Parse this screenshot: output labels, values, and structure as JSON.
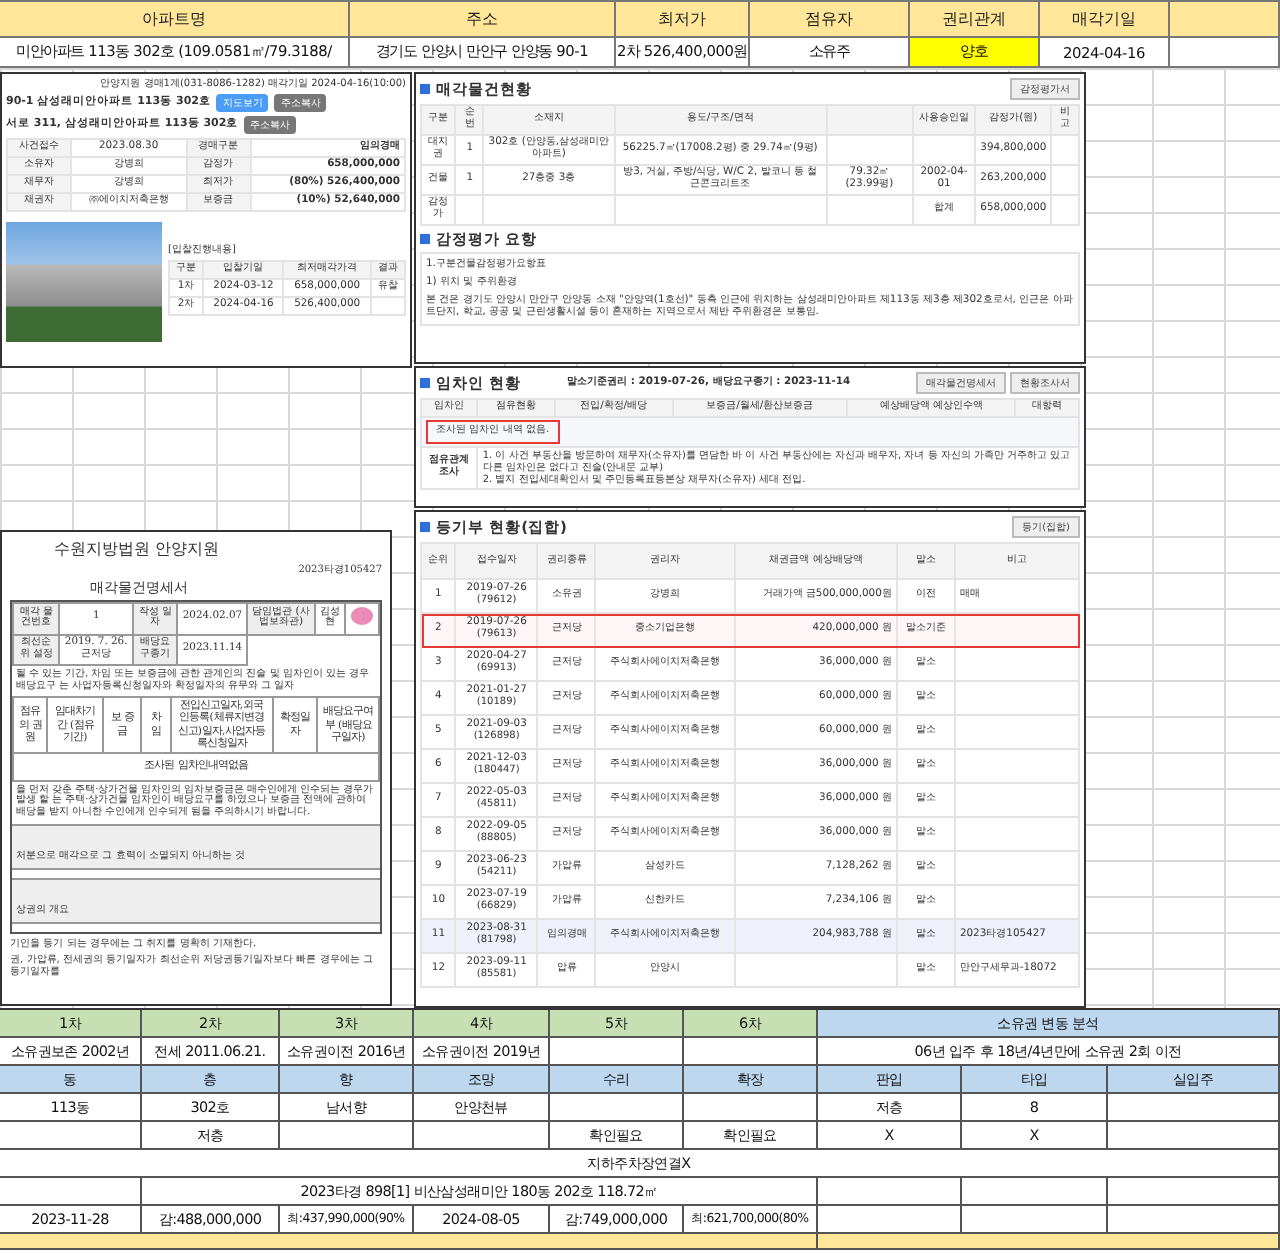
{
  "sheet": {
    "columns": [
      "아파트명",
      "주소",
      "최저가",
      "점유자",
      "권리관계",
      "매각기일"
    ],
    "row": [
      {
        "text": "미안아파트 113동 302호 (109.0581㎡/79.3188/",
        "highlighted": false
      },
      {
        "text": "경기도 안양시 만안구 안양동 90-1",
        "highlighted": false
      },
      {
        "text": "2차 526,400,000원",
        "highlighted": false
      },
      {
        "text": "소유주",
        "highlighted": false
      },
      {
        "text": "양호",
        "highlighted": true
      },
      {
        "text": "2024-04-16",
        "highlighted": false
      }
    ]
  },
  "auction_card": {
    "court_line": "안양지원 경매1계(031-8086-1282) 매각기일 2024-04-16(10:00)",
    "address_lines": [
      {
        "text": "90-1 삼성래미안아파트 113동 302호",
        "buttons": [
          {
            "label": "지도보기",
            "kind": "primary"
          },
          {
            "label": "주소복사",
            "kind": "plain"
          }
        ]
      },
      {
        "text": "서로 311, 삼성래미안아파트 113동 302호",
        "buttons": [
          {
            "label": "주소복사",
            "kind": "plain"
          }
        ]
      }
    ],
    "info": [
      [
        "사건접수",
        "2023.08.30",
        "경매구분",
        "임의경매"
      ],
      [
        "소유자",
        "강병희",
        "감정가",
        "658,000,000"
      ],
      [
        "채무자",
        "강병희",
        "최저가",
        "(80%) 526,400,000"
      ],
      [
        "채권자",
        "㈜에이치저축은행",
        "보증금",
        "(10%) 52,640,000"
      ]
    ],
    "rounds_title": "[입찰진행내용]",
    "rounds_columns": [
      "구분",
      "입찰기일",
      "최저매각가격",
      "결과"
    ],
    "rounds": [
      [
        "1차",
        "2024-03-12",
        "658,000,000",
        "유찰"
      ],
      [
        "2차",
        "2024-04-16",
        "526,400,000"
      ]
    ]
  },
  "property_panel": {
    "title": "매각물건현황",
    "button": "감정평가서",
    "columns": [
      "구분",
      "순번",
      "소재지",
      "용도/구조/면적",
      "",
      "사용승인일",
      "감정가(원)",
      "비고"
    ],
    "rows": [
      [
        "대지권",
        "1",
        "302호 (안양동,삼성래미안아파트)",
        "56225.7㎡(17008.2평) 중 29.74㎡(9평)",
        "",
        "",
        "394,800,000",
        ""
      ],
      [
        "건물",
        "1",
        "27층중 3층",
        "방3, 거실, 주방/식당, W/C 2, 발코니 등 철근콘크리트조",
        "79.32㎡ (23.99평)",
        "2002-04-01",
        "263,200,000",
        ""
      ],
      [
        "감정가",
        "",
        "",
        "",
        "",
        "합계",
        "658,000,000",
        ""
      ]
    ],
    "summary_title": "감정평가 요항",
    "summary": [
      "1.구분건물감정평가요항표",
      "1) 위치 및 주위환경",
      "본 건은 경기도 안양시 만안구 안양동 소재 \"안양역(1호선)\" 동측 인근에 위치하는 삼성래미안아파트 제113동 제3층 제302호로서, 인근은 아파트단지, 학교, 공공 및 근린생활시설 등이 혼재하는 지역으로서 제반 주위환경은 보통임."
    ]
  },
  "tenant_panel": {
    "title": "임차인 현황",
    "dates": "말소기준권리 : 2019-07-26, 배당요구종기 : 2023-11-14",
    "buttons": [
      "매각물건명세서",
      "현황조사서"
    ],
    "columns": [
      "임차인",
      "점유현황",
      "전입/확정/배당",
      "보증금/월세/환산보증금",
      "예상배당액 예상인수액",
      "대항력"
    ],
    "note": {
      "text": "조사된 임차인 내역 없음.",
      "boxed": true
    },
    "survey_label": "점유관계조사",
    "survey": [
      "1. 이 사건 부동산을 방문하여 채무자(소유자)를 면담한 바 이 사건 부동산에는 자신과 배우자, 자녀 등 자신의 가족만 거주하고 있고 다른 임차인은 없다고 진술(안내문 교부)",
      "2. 별지 전입세대확인서 및 주민등록표등본상 채무자(소유자) 세대 전입."
    ]
  },
  "court_document": {
    "court": "수원지방법원 안양지원",
    "case_no": "2023타경105427",
    "title": "매각물건명세서",
    "head_rows": [
      [
        "매각 물건번호",
        "1",
        "작성 일자",
        "2024.02.07",
        "담임법관 (사법보좌관)",
        "김성현"
      ],
      [
        "최선순위 설정",
        "2019. 7. 26. 근저당",
        "배당요구종기",
        "2023.11.14"
      ]
    ],
    "intro": "될 수 있는 기간, 차임 또는 보증금에 관한 관계인의 진술 및 임차인이 있는 경우 배당요구 는 사업자등록신청일자와 확정일자의 유무와 그 일자",
    "columns": [
      "점유의 권 원",
      "임대차기간 (점유기간)",
      "보 증 금",
      "차 임",
      "전입신고일자,외국인등록(체류지변경신고)일자,사업자등록신청일자",
      "확정일자",
      "배당요구여부 (배당요구일자)"
    ],
    "empty_text": "조사된 임차인내역없음",
    "warning": "을 먼저 갖춘 주택·상가건물 임차인의 임차보증금은 매수인에게 인수되는 경우가 발생 할 는 주택·상가건물 임차인이 배당요구를 하였으나 보증금 전액에 관하여 배당을 받지 아니한 수인에게 인수되게 됨을 주의하시기 바랍니다.",
    "sections": [
      "처분으로 매각으로 그 효력이 소멸되지 아니하는 것",
      "상권의 개요"
    ],
    "footnotes": [
      "기인을 등기 되는 경우에는 그 취지를 명확히 기재한다.",
      "권, 가압류, 전세권의 등기일자가 최선순위 저당권등기일자보다 빠른 경우에는 그 등기일자를"
    ]
  },
  "registry_panel": {
    "title": "등기부 현황(집합)",
    "button": "등기(집합)",
    "columns": [
      "순위",
      "접수일자",
      "권리종류",
      "권리자",
      "채권금액 예상배당액",
      "말소",
      "비고"
    ],
    "rows": [
      {
        "no": "1",
        "date": "2019-07-26",
        "receipt": "(79612)",
        "type": "소유권",
        "holder": "강병희",
        "amount": "거래가액 금500,000,000원",
        "status": "이전",
        "note": "매매",
        "boxed": false,
        "highlighted": false
      },
      {
        "no": "2",
        "date": "2019-07-26",
        "receipt": "(79613)",
        "type": "근저당",
        "holder": "중소기업은행",
        "amount": "420,000,000 원",
        "status": "말소기준",
        "note": "",
        "boxed": true,
        "highlighted": false
      },
      {
        "no": "3",
        "date": "2020-04-27",
        "receipt": "(69913)",
        "type": "근저당",
        "holder": "주식회사에이치저축은행",
        "amount": "36,000,000 원",
        "status": "말소",
        "note": "",
        "boxed": false,
        "highlighted": false
      },
      {
        "no": "4",
        "date": "2021-01-27",
        "receipt": "(10189)",
        "type": "근저당",
        "holder": "주식회사에이치저축은행",
        "amount": "60,000,000 원",
        "status": "말소",
        "note": "",
        "boxed": false,
        "highlighted": false
      },
      {
        "no": "5",
        "date": "2021-09-03",
        "receipt": "(126898)",
        "type": "근저당",
        "holder": "주식회사에이치저축은행",
        "amount": "60,000,000 원",
        "status": "말소",
        "note": "",
        "boxed": false,
        "highlighted": false
      },
      {
        "no": "6",
        "date": "2021-12-03",
        "receipt": "(180447)",
        "type": "근저당",
        "holder": "주식회사에이치저축은행",
        "amount": "36,000,000 원",
        "status": "말소",
        "note": "",
        "boxed": false,
        "highlighted": false
      },
      {
        "no": "7",
        "date": "2022-05-03",
        "receipt": "(45811)",
        "type": "근저당",
        "holder": "주식회사에이치저축은행",
        "amount": "36,000,000 원",
        "status": "말소",
        "note": "",
        "boxed": false,
        "highlighted": false
      },
      {
        "no": "8",
        "date": "2022-09-05",
        "receipt": "(88805)",
        "type": "근저당",
        "holder": "주식회사에이치저축은행",
        "amount": "36,000,000 원",
        "status": "말소",
        "note": "",
        "boxed": false,
        "highlighted": false
      },
      {
        "no": "9",
        "date": "2023-06-23",
        "receipt": "(54211)",
        "type": "가압류",
        "holder": "삼성카드",
        "amount": "7,128,262 원",
        "status": "말소",
        "note": "",
        "boxed": false,
        "highlighted": false
      },
      {
        "no": "10",
        "date": "2023-07-19",
        "receipt": "(66829)",
        "type": "가압류",
        "holder": "신한카드",
        "amount": "7,234,106 원",
        "status": "말소",
        "note": "",
        "boxed": false,
        "highlighted": false
      },
      {
        "no": "11",
        "date": "2023-08-31",
        "receipt": "(81798)",
        "type": "임의경매",
        "holder": "주식회사에이치저축은행",
        "amount": "204,983,788 원",
        "status": "말소",
        "note": "2023타경105427",
        "boxed": false,
        "highlighted": true
      },
      {
        "no": "12",
        "date": "2023-09-11",
        "receipt": "(85581)",
        "type": "압류",
        "holder": "안양시",
        "amount": "",
        "status": "말소",
        "note": "만안구세무과-18072",
        "boxed": false,
        "highlighted": false
      }
    ]
  },
  "bottom": {
    "rounds": [
      "1차",
      "2차",
      "3차",
      "4차",
      "5차",
      "6차"
    ],
    "analysis_title": "소유권 변동 분석",
    "round_values": [
      "소유권보존 2002년",
      "전세 2011.06.21.",
      "소유권이전 2016년",
      "소유권이전 2019년"
    ],
    "analysis_value": "06년 입주 후 18년/4년만에 소유권 2회 이전",
    "attr_columns": [
      "동",
      "층",
      "향",
      "조망",
      "수리",
      "확장",
      "판입",
      "타입",
      "실입주"
    ],
    "attr_rows": [
      [
        "113동",
        "302호",
        "남서향",
        "안양천뷰",
        "",
        "",
        "저층",
        "8",
        ""
      ],
      [
        "",
        "저층",
        "",
        "",
        "확인필요",
        "확인필요",
        "X",
        "X",
        ""
      ]
    ],
    "parking": "지하주차장연결X",
    "compare_title": "2023타경 898[1] 비산삼성래미안 180동 202호 118.72㎡",
    "compare_values": [
      "2023-11-28",
      "감:488,000,000",
      "최:437,990,000(90%",
      "2024-08-05",
      "감:749,000,000",
      "최:621,700,000(80%"
    ]
  }
}
